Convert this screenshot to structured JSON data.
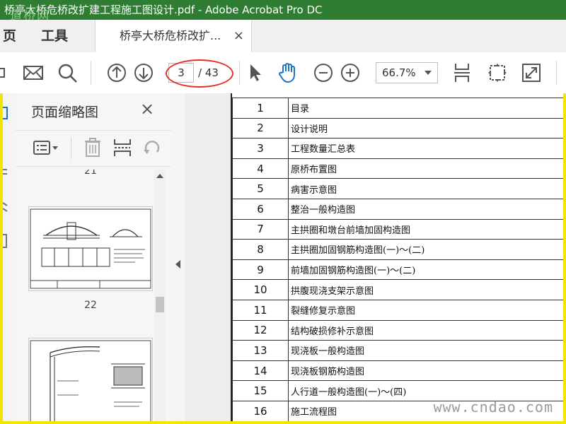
{
  "window": {
    "title": "桥亭大桥危桥改扩建工程施工图设计.pdf - Adobe Acrobat Pro DC",
    "watermark": "道桥网"
  },
  "tabs": {
    "home": "页",
    "tools": "工具",
    "document": "桥亭大桥危桥改扩...",
    "close": "×"
  },
  "toolbar": {
    "current_page": "3",
    "total_pages": "/ 43",
    "zoom": "66.7%"
  },
  "thumbnail_panel": {
    "title": "页面缩略图",
    "close": "×",
    "partial_number": "21",
    "thumbnails": [
      {
        "page": "22"
      }
    ]
  },
  "toc": [
    {
      "num": "1",
      "title": "目录"
    },
    {
      "num": "2",
      "title": "设计说明"
    },
    {
      "num": "3",
      "title": "工程数量汇总表"
    },
    {
      "num": "4",
      "title": "原桥布置图"
    },
    {
      "num": "5",
      "title": "病害示意图"
    },
    {
      "num": "6",
      "title": "整治一般构造图"
    },
    {
      "num": "7",
      "title": "主拱圈和墩台前墙加固构造图"
    },
    {
      "num": "8",
      "title": "主拱圈加固钢筋构造图(一)～(二)"
    },
    {
      "num": "9",
      "title": "前墙加固钢筋构造图(一)～(二)"
    },
    {
      "num": "10",
      "title": "拱腹现浇支架示意图"
    },
    {
      "num": "11",
      "title": "裂缝修复示意图"
    },
    {
      "num": "12",
      "title": "结构破损修补示意图"
    },
    {
      "num": "13",
      "title": "现浇板一般构造图"
    },
    {
      "num": "14",
      "title": "现浇板钢筋构造图"
    },
    {
      "num": "15",
      "title": "人行道一般构造图(一)～(四)"
    },
    {
      "num": "16",
      "title": "施工流程图"
    }
  ],
  "site_watermark": "www.cndao.com",
  "colors": {
    "titlebar": "#2e7d32",
    "frame": "#f3e500",
    "annotation": "#e03030",
    "hand_tool": "#1a73c9"
  }
}
